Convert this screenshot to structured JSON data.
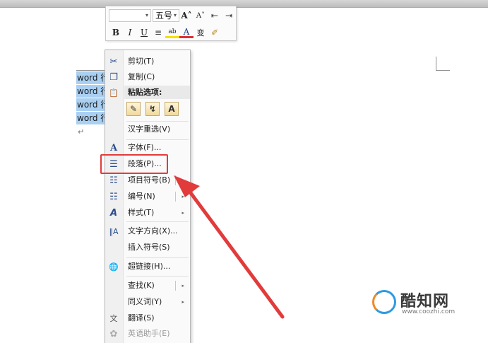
{
  "document": {
    "lines": [
      "word 行",
      "word 行",
      "word 行",
      "word 行"
    ],
    "paragraph_mark": "↵"
  },
  "mini_toolbar": {
    "font_size": "五号",
    "dropdown_caret": "▾",
    "row1_buttons": [
      {
        "icon": "grow-font-icon",
        "glyph": "A˄"
      },
      {
        "icon": "shrink-font-icon",
        "glyph": "A˅"
      },
      {
        "icon": "decrease-indent-icon",
        "glyph": "⇤"
      },
      {
        "icon": "increase-indent-icon",
        "glyph": "⇥"
      }
    ],
    "row2_buttons": [
      {
        "icon": "bold-icon",
        "glyph": "B"
      },
      {
        "icon": "italic-icon",
        "glyph": "I"
      },
      {
        "icon": "underline-icon",
        "glyph": "U"
      },
      {
        "icon": "center-align-icon",
        "glyph": "≡"
      },
      {
        "icon": "highlight-icon",
        "glyph": "ab"
      },
      {
        "icon": "font-color-icon",
        "glyph": "A"
      },
      {
        "icon": "phonetic-guide-icon",
        "glyph": "变"
      },
      {
        "icon": "format-painter-icon",
        "glyph": "✐"
      }
    ]
  },
  "context_menu": {
    "items": [
      {
        "label": "剪切(T)",
        "icon": "cut-icon",
        "glyph": "✂"
      },
      {
        "label": "复制(C)",
        "icon": "copy-icon",
        "glyph": "❐"
      },
      {
        "label": "粘贴选项:",
        "icon": "paste-icon",
        "glyph": "📋"
      },
      {
        "label": "汉字重选(V)"
      },
      {
        "label": "字体(F)...",
        "icon": "font-icon",
        "glyph": "A"
      },
      {
        "label": "段落(P)...",
        "icon": "paragraph-icon",
        "glyph": "☰"
      },
      {
        "label": "项目符号(B)",
        "icon": "bullets-icon",
        "glyph": "☷"
      },
      {
        "label": "编号(N)",
        "icon": "numbering-icon",
        "glyph": "☷"
      },
      {
        "label": "样式(T)",
        "icon": "styles-icon",
        "glyph": "A"
      },
      {
        "label": "文字方向(X)...",
        "icon": "text-direction-icon",
        "glyph": "‖A"
      },
      {
        "label": "插入符号(S)"
      },
      {
        "label": "超链接(H)...",
        "icon": "hyperlink-icon",
        "glyph": "🌐"
      },
      {
        "label": "查找(K)"
      },
      {
        "label": "同义词(Y)"
      },
      {
        "label": "翻译(S)",
        "icon": "translate-icon",
        "glyph": "文"
      },
      {
        "label": "英语助手(E)",
        "icon": "english-assistant-icon",
        "glyph": "✿"
      }
    ],
    "paste_buttons": [
      {
        "icon": "paste-keep-format-icon",
        "glyph": "✎"
      },
      {
        "icon": "paste-merge-format-icon",
        "glyph": "↯"
      },
      {
        "icon": "paste-text-only-icon",
        "glyph": "A"
      }
    ],
    "submenu_arrow": "▸"
  },
  "watermark": {
    "name": "酷知网",
    "url": "www.coozhi.com"
  },
  "colors": {
    "selection": "#a9d0f2",
    "highlight_box": "#e23b3b",
    "arrow": "#e23b3b"
  }
}
